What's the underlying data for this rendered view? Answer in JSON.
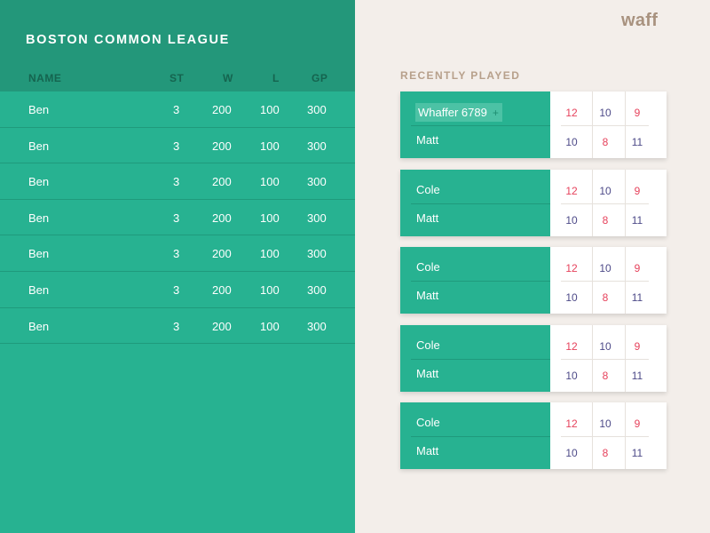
{
  "league": {
    "title": "BOSTON COMMON LEAGUE",
    "columns": {
      "name": "NAME",
      "st": "ST",
      "w": "W",
      "l": "L",
      "gp": "GP"
    },
    "rows": [
      {
        "name": "Ben",
        "st": "3",
        "w": "200",
        "l": "100",
        "gp": "300"
      },
      {
        "name": "Ben",
        "st": "3",
        "w": "200",
        "l": "100",
        "gp": "300"
      },
      {
        "name": "Ben",
        "st": "3",
        "w": "200",
        "l": "100",
        "gp": "300"
      },
      {
        "name": "Ben",
        "st": "3",
        "w": "200",
        "l": "100",
        "gp": "300"
      },
      {
        "name": "Ben",
        "st": "3",
        "w": "200",
        "l": "100",
        "gp": "300"
      },
      {
        "name": "Ben",
        "st": "3",
        "w": "200",
        "l": "100",
        "gp": "300"
      },
      {
        "name": "Ben",
        "st": "3",
        "w": "200",
        "l": "100",
        "gp": "300"
      }
    ]
  },
  "brand": {
    "logo": "waff"
  },
  "recent": {
    "title": "RECENTLY PLAYED",
    "add_icon": "plus-icon",
    "add_glyph": "+",
    "matches": [
      {
        "p1": "Whaffer 6789",
        "p2": "Matt",
        "p1_scores": [
          "12",
          "10",
          "9"
        ],
        "p2_scores": [
          "10",
          "8",
          "11"
        ]
      },
      {
        "p1": "Cole",
        "p2": "Matt",
        "p1_scores": [
          "12",
          "10",
          "9"
        ],
        "p2_scores": [
          "10",
          "8",
          "11"
        ]
      },
      {
        "p1": "Cole",
        "p2": "Matt",
        "p1_scores": [
          "12",
          "10",
          "9"
        ],
        "p2_scores": [
          "10",
          "8",
          "11"
        ]
      },
      {
        "p1": "Cole",
        "p2": "Matt",
        "p1_scores": [
          "12",
          "10",
          "9"
        ],
        "p2_scores": [
          "10",
          "8",
          "11"
        ]
      },
      {
        "p1": "Cole",
        "p2": "Matt",
        "p1_scores": [
          "12",
          "10",
          "9"
        ],
        "p2_scores": [
          "10",
          "8",
          "11"
        ]
      }
    ]
  },
  "colors": {
    "accent": "#27b291",
    "header": "#23977a",
    "win": "#e6425c",
    "loss": "#4d4a88",
    "background": "#f3eeea"
  }
}
